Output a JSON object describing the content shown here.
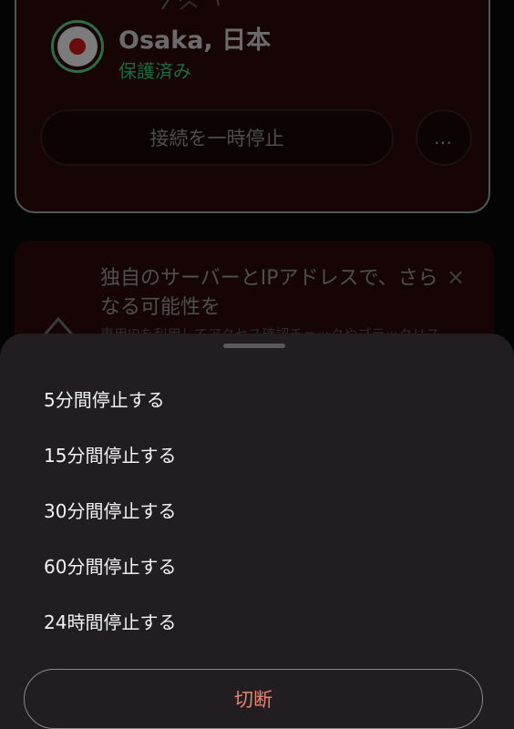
{
  "background": {
    "connection_card": {
      "location": "Osaka, 日本",
      "status": "保護済み",
      "pause_button_label": "接続を一時停止",
      "more_button_label": "…"
    },
    "promo_card": {
      "title": "独自のサーバーとIPアドレスで、さらなる可能性を",
      "subtitle": "専用IPを利用してアクセス確認チェックやブラックリス",
      "close_label": "×"
    }
  },
  "sheet": {
    "options": [
      {
        "label": "5分間停止する"
      },
      {
        "label": "15分間停止する"
      },
      {
        "label": "30分間停止する"
      },
      {
        "label": "60分間停止する"
      },
      {
        "label": "24時間停止する"
      }
    ],
    "disconnect_label": "切断"
  },
  "colors": {
    "sheet_background": "#221d21",
    "disconnect_text": "#e8836f",
    "protected_status": "#1f6a40"
  },
  "icons": {
    "flag": "japan-flag-icon",
    "more": "more-horizontal-icon",
    "close": "close-icon",
    "promo": "server-icon",
    "map": "map-sketch-icon"
  }
}
